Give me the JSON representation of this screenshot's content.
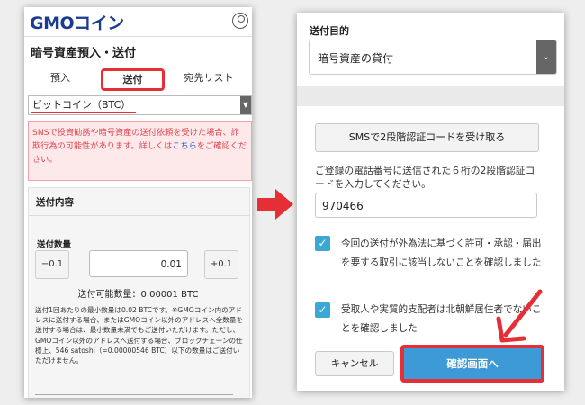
{
  "left": {
    "logo": "GMOコイン",
    "page_title": "暗号資産預入・送付",
    "tabs": [
      "預入",
      "送付",
      "宛先リスト"
    ],
    "coin_select": "ビットコイン（BTC）",
    "warning_pre": "SNSで投資勧誘や暗号資産の送付依頼を受けた場合、詐欺行為の可能性があります。詳しくは",
    "warning_link": "こちら",
    "warning_post": "をご確認ください。",
    "section_title": "送付内容",
    "qty_label": "送付数量",
    "minus": "−0.1",
    "qty_value": "0.01",
    "plus": "+0.1",
    "available": "送付可能数量：0.00001 BTC",
    "notes": "送付1回あたりの最小数量は0.02 BTCです。※GMOコイン内のアドレスに送付する場合、またはGMOコイン以外のアドレスへ全数量を送付する場合は、最小数量未満でもご送付いただけます。ただし、GMOコイン以外のアドレスへ送付する場合、ブロックチェーンの仕様上、546 satoshi（=0.00000546 BTC）以下の数量はご送付いただけません。"
  },
  "right": {
    "purpose_label": "送付目的",
    "purpose_value": "暗号資産の貸付",
    "sms_button": "SMSで2段階認証コードを受け取る",
    "sms_description": "ご登録の電話番号に送信された６桁の2段階認証コードを入力してください。",
    "code_value": "970466",
    "check1": "今回の送付が外為法に基づく許可・承認・届出を要する取引に該当しないことを確認しました",
    "check2": "受取人や実質的支配者は北朝鮮居住者でないことを確認しました",
    "cancel": "キャンセル",
    "confirm": "確認画面へ"
  },
  "colors": {
    "highlight_red": "#e62e36",
    "confirm_blue": "#3e9ad6",
    "checkbox_blue": "#3ba7d4",
    "brand_navy": "#1a3b8e"
  }
}
